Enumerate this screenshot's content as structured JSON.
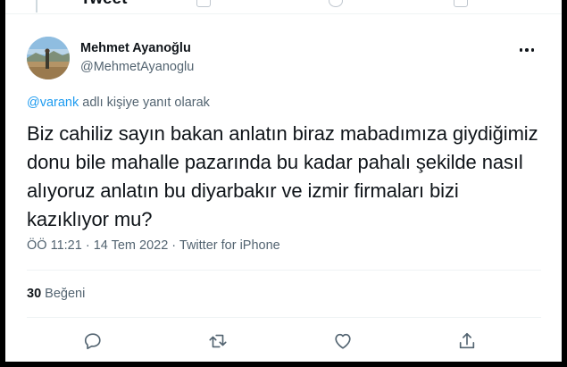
{
  "partial_header": {
    "title": "Tweet"
  },
  "author": {
    "name": "Mehmet Ayanoğlu",
    "handle": "@MehmetAyanoglu"
  },
  "reply_context": {
    "mention": "@varank",
    "suffix": " adlı kişiye yanıt olarak"
  },
  "tweet": {
    "text": "Biz cahiliz sayın bakan anlatın biraz mabadımıza giydiğimiz donu bile mahalle pazarında bu kadar pahalı şekilde nasıl alıyoruz anlatın bu diyarbakır ve izmir firmaları bizi kazıklıyor mu?",
    "time": "ÖÖ 11:21",
    "separator_1": " · ",
    "date": "14 Tem 2022",
    "separator_2": " · ",
    "source": "Twitter for iPhone"
  },
  "stats": {
    "likes_count": "30",
    "likes_label": " Beğeni"
  },
  "actions": {
    "reply": "reply-icon",
    "retweet": "retweet-icon",
    "like": "heart-icon",
    "share": "share-icon"
  },
  "colors": {
    "accent": "#1d9bf0",
    "text_primary": "#0f1419",
    "text_secondary": "#536471",
    "divider": "#eff3f4"
  }
}
